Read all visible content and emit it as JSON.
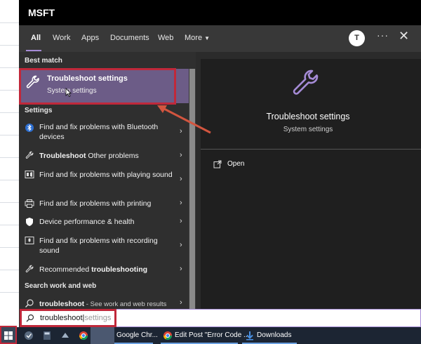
{
  "window": {
    "title": "MSFT"
  },
  "tabs": [
    {
      "label": "All"
    },
    {
      "label": "Work"
    },
    {
      "label": "Apps"
    },
    {
      "label": "Documents"
    },
    {
      "label": "Web"
    },
    {
      "label": "More"
    }
  ],
  "header": {
    "avatar_letter": "T",
    "more_dots": "···",
    "close": "✕"
  },
  "results": {
    "best_match_label": "Best match",
    "best": {
      "title": "Troubleshoot settings",
      "subtitle": "System settings"
    },
    "settings_label": "Settings",
    "items": [
      {
        "text": "Find and fix problems with Bluetooth devices",
        "icon": "bluetooth-icon"
      },
      {
        "text_bold": "Troubleshoot",
        "text_rest": " Other problems",
        "icon": "wrench-icon"
      },
      {
        "text": "Find and fix problems with playing sound",
        "icon": "speaker-icon"
      },
      {
        "text": "Find and fix problems with printing",
        "icon": "printer-icon"
      },
      {
        "text": "Device performance & health",
        "icon": "shield-icon"
      },
      {
        "text": "Find and fix problems with recording sound",
        "icon": "microphone-icon"
      },
      {
        "text_rest": "Recommended ",
        "text_bold": "troubleshooting",
        "icon": "wrench-icon"
      }
    ],
    "web_label": "Search work and web",
    "web_item": {
      "bold": "troubleshoot",
      "rest": " - See work and web results"
    }
  },
  "detail": {
    "title": "Troubleshoot settings",
    "subtitle": "System settings",
    "open_label": "Open"
  },
  "search": {
    "typed": "troubleshoot",
    "hint": "settings"
  },
  "taskbar": {
    "apps": [
      {
        "label": "Google Chr..."
      },
      {
        "label": "Edit Post \"Error Code ..."
      },
      {
        "label": "Downloads"
      }
    ]
  },
  "colors": {
    "accent": "#a58bd6",
    "highlight": "#6c5c87",
    "annotation": "#c0283a"
  }
}
